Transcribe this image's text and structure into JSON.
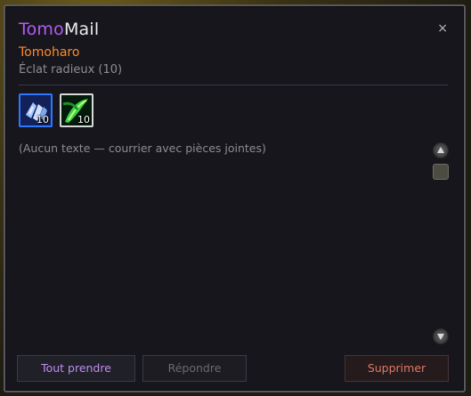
{
  "window": {
    "title_part1": "Tomo",
    "title_part2": "Mail",
    "close_glyph": "×"
  },
  "mail": {
    "sender": "Tomoharo",
    "subject": "Éclat radieux (10)",
    "body": "(Aucun texte — courrier avec pièces jointes)"
  },
  "attachments": [
    {
      "icon": "radiant-shard-icon",
      "count": "10",
      "border_color": "#2e78ff"
    },
    {
      "icon": "green-leaf-icon",
      "count": "10",
      "border_color": "#d9d9d9"
    }
  ],
  "buttons": {
    "take_all": "Tout prendre",
    "reply": "Répondre",
    "delete": "Supprimer"
  },
  "colors": {
    "accent_purple": "#b25cf0",
    "sender_orange": "#ff8a28",
    "delete_red": "#e07868"
  }
}
